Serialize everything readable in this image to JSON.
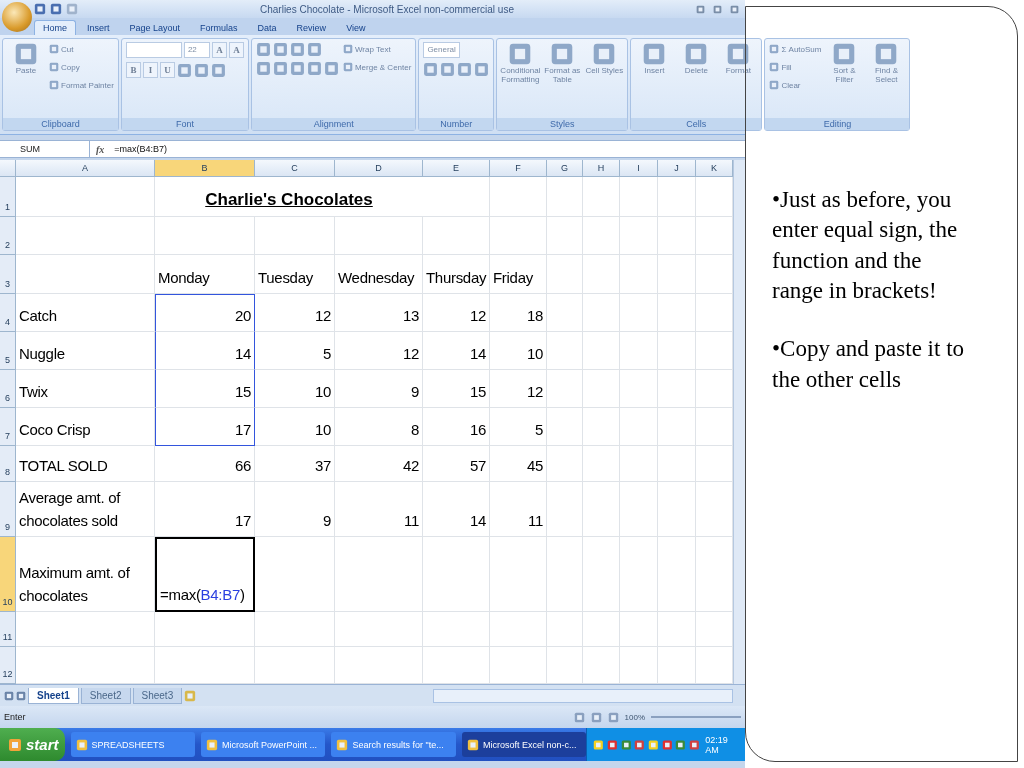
{
  "excel": {
    "title": "Charlies Chocolate - Microsoft Excel non-commercial use",
    "tabs": [
      {
        "label": "Home",
        "selected": true
      },
      {
        "label": "Insert",
        "selected": false
      },
      {
        "label": "Page Layout",
        "selected": false
      },
      {
        "label": "Formulas",
        "selected": false
      },
      {
        "label": "Data",
        "selected": false
      },
      {
        "label": "Review",
        "selected": false
      },
      {
        "label": "View",
        "selected": false
      }
    ],
    "ribbon_groups": [
      {
        "label": "Clipboard",
        "stacks": [
          [
            [
              {
                "kind": "large",
                "label": "Paste"
              }
            ]
          ],
          [
            [
              {
                "kind": "small",
                "label": "Cut"
              }
            ],
            [
              {
                "kind": "small",
                "label": "Copy"
              }
            ],
            [
              {
                "kind": "small",
                "label": "Format Painter"
              }
            ]
          ]
        ]
      },
      {
        "label": "Font",
        "stacks": [
          [
            [
              {
                "kind": "field"
              },
              {
                "kind": "field",
                "value": "22"
              },
              {
                "kind": "glyph",
                "label": "A"
              },
              {
                "kind": "glyph",
                "label": "A"
              }
            ],
            [
              {
                "kind": "glyph",
                "label": "B"
              },
              {
                "kind": "glyph",
                "label": "I"
              },
              {
                "kind": "glyph",
                "label": "U"
              },
              {
                "kind": "icon"
              },
              {
                "kind": "icon"
              },
              {
                "kind": "icon"
              }
            ]
          ]
        ]
      },
      {
        "label": "Alignment",
        "stacks": [
          [
            [
              {
                "kind": "icon"
              },
              {
                "kind": "icon"
              },
              {
                "kind": "icon"
              },
              {
                "kind": "icon"
              }
            ],
            [
              {
                "kind": "icon"
              },
              {
                "kind": "icon"
              },
              {
                "kind": "icon"
              },
              {
                "kind": "icon"
              },
              {
                "kind": "icon"
              }
            ]
          ],
          [
            [
              {
                "kind": "small",
                "label": "Wrap Text"
              }
            ],
            [
              {
                "kind": "small",
                "label": "Merge & Center"
              }
            ]
          ]
        ]
      },
      {
        "label": "Number",
        "stacks": [
          [
            [
              {
                "kind": "field",
                "value": "General"
              }
            ],
            [
              {
                "kind": "icon"
              },
              {
                "kind": "icon"
              },
              {
                "kind": "icon"
              },
              {
                "kind": "icon"
              }
            ]
          ]
        ]
      },
      {
        "label": "Styles",
        "stacks": [
          [
            [
              {
                "kind": "large",
                "label": "Conditional Formatting"
              }
            ]
          ],
          [
            [
              {
                "kind": "large",
                "label": "Format as Table"
              }
            ]
          ],
          [
            [
              {
                "kind": "large",
                "label": "Cell Styles"
              }
            ]
          ]
        ]
      },
      {
        "label": "Cells",
        "stacks": [
          [
            [
              {
                "kind": "large",
                "label": "Insert"
              }
            ]
          ],
          [
            [
              {
                "kind": "large",
                "label": "Delete"
              }
            ]
          ],
          [
            [
              {
                "kind": "large",
                "label": "Format"
              }
            ]
          ]
        ]
      },
      {
        "label": "Editing",
        "stacks": [
          [
            [
              {
                "kind": "small",
                "label": "Σ AutoSum"
              }
            ],
            [
              {
                "kind": "small",
                "label": "Fill"
              }
            ],
            [
              {
                "kind": "small",
                "label": "Clear"
              }
            ]
          ],
          [
            [
              {
                "kind": "large",
                "label": "Sort & Filter"
              }
            ]
          ],
          [
            [
              {
                "kind": "large",
                "label": "Find & Select"
              }
            ]
          ]
        ]
      }
    ],
    "name_box": "SUM",
    "fx": "fx",
    "formula": "=max(B4:B7)",
    "columns": [
      {
        "label": "A",
        "selected": false
      },
      {
        "label": "B",
        "selected": true
      },
      {
        "label": "C",
        "selected": false
      },
      {
        "label": "D",
        "selected": false
      },
      {
        "label": "E",
        "selected": false
      },
      {
        "label": "F",
        "selected": false
      },
      {
        "label": "G",
        "selected": false
      },
      {
        "label": "H",
        "selected": false
      },
      {
        "label": "I",
        "selected": false
      },
      {
        "label": "J",
        "selected": false
      },
      {
        "label": "K",
        "selected": false
      }
    ],
    "rows": [
      {
        "number": "1",
        "kind": "title",
        "selected": false,
        "title": "Charlie's Chocolates"
      },
      {
        "number": "2",
        "kind": "blank",
        "selected": false
      },
      {
        "number": "3",
        "kind": "header",
        "selected": false,
        "values": [
          "Monday",
          "Tuesday",
          "Wednesday",
          "Thursday",
          "Friday"
        ]
      },
      {
        "number": "4",
        "kind": "data",
        "selected": false,
        "in_range": true,
        "label": "Catch",
        "values": [
          "20",
          "12",
          "13",
          "12",
          "18"
        ]
      },
      {
        "number": "5",
        "kind": "data",
        "selected": false,
        "in_range": true,
        "label": "Nuggle",
        "values": [
          "14",
          "5",
          "12",
          "14",
          "10"
        ]
      },
      {
        "number": "6",
        "kind": "data",
        "selected": false,
        "in_range": true,
        "label": "Twix",
        "values": [
          "15",
          "10",
          "9",
          "15",
          "12"
        ]
      },
      {
        "number": "7",
        "kind": "data",
        "selected": false,
        "in_range": true,
        "label": "Coco Crisp",
        "values": [
          "17",
          "10",
          "8",
          "16",
          "5"
        ]
      },
      {
        "number": "8",
        "kind": "data",
        "selected": false,
        "in_range": false,
        "label": "TOTAL SOLD",
        "values": [
          "66",
          "37",
          "42",
          "57",
          "45"
        ]
      },
      {
        "number": "9",
        "kind": "data",
        "selected": false,
        "in_range": false,
        "label": "Average amt. of chocolates sold",
        "values": [
          "17",
          "9",
          "11",
          "14",
          "11"
        ]
      },
      {
        "number": "10",
        "kind": "formula",
        "selected": true,
        "label": "Maximum amt. of chocolates",
        "parts": [
          {
            "text": "=max(",
            "kind": "plain"
          },
          {
            "text": "B4:B7",
            "kind": "reference"
          },
          {
            "text": ")",
            "kind": "plain"
          }
        ]
      },
      {
        "number": "11",
        "kind": "blank",
        "selected": false
      },
      {
        "number": "12",
        "kind": "blank",
        "selected": false
      }
    ],
    "sheets": [
      {
        "label": "Sheet1",
        "selected": true
      },
      {
        "label": "Sheet2",
        "selected": false
      },
      {
        "label": "Sheet3",
        "selected": false
      }
    ],
    "status": "Enter",
    "zoom": "100%",
    "taskbar": {
      "start": "start",
      "items": [
        {
          "label": "SPREADSHEETS",
          "selected": false
        },
        {
          "label": "Microsoft PowerPoint ...",
          "selected": false
        },
        {
          "label": "Search results for \"te...",
          "selected": false
        },
        {
          "label": "Microsoft Excel non-c...",
          "selected": true
        }
      ],
      "clock": "02:19 AM"
    }
  },
  "slide": {
    "bullets": [
      "•Just as before, you enter equal sign, the function  and the range in brackets!",
      "•Copy and paste it to the other cells"
    ]
  }
}
